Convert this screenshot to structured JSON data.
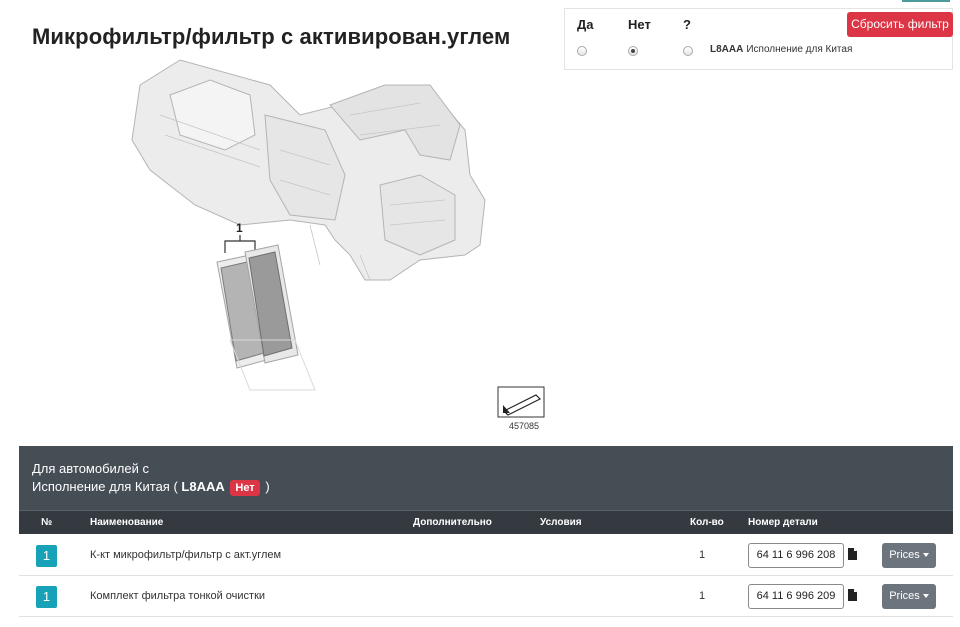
{
  "title": "Микрофильтр/фильтр с активирован.углем",
  "filter": {
    "col_yes": "Да",
    "col_no": "Нет",
    "col_unknown": "?",
    "reset_label": "Сбросить фильтр",
    "option_code": "L8AAA",
    "option_label": "Исполнение для Китая",
    "selected": "Нет"
  },
  "diagram": {
    "callout": "1",
    "image_number": "457085"
  },
  "banner": {
    "line1": "Для автомобилей с",
    "line2_prefix": "Исполнение для Китая (",
    "code": "L8AAA",
    "badge": "Нет",
    "line2_suffix": ")"
  },
  "table": {
    "headers": {
      "num": "№",
      "name": "Наименование",
      "extra": "Дополнительно",
      "conditions": "Условия",
      "qty": "Кол-во",
      "part_number": "Номер детали"
    },
    "rows": [
      {
        "pos": "1",
        "name": "К-кт микрофильтр/фильтр с акт.углем",
        "qty": "1",
        "part_number": "64 11 6 996 208",
        "prices_label": "Prices"
      },
      {
        "pos": "1",
        "name": "Комплект фильтра тонкой очистки",
        "qty": "1",
        "part_number": "64 11 6 996 209",
        "prices_label": "Prices"
      }
    ]
  }
}
